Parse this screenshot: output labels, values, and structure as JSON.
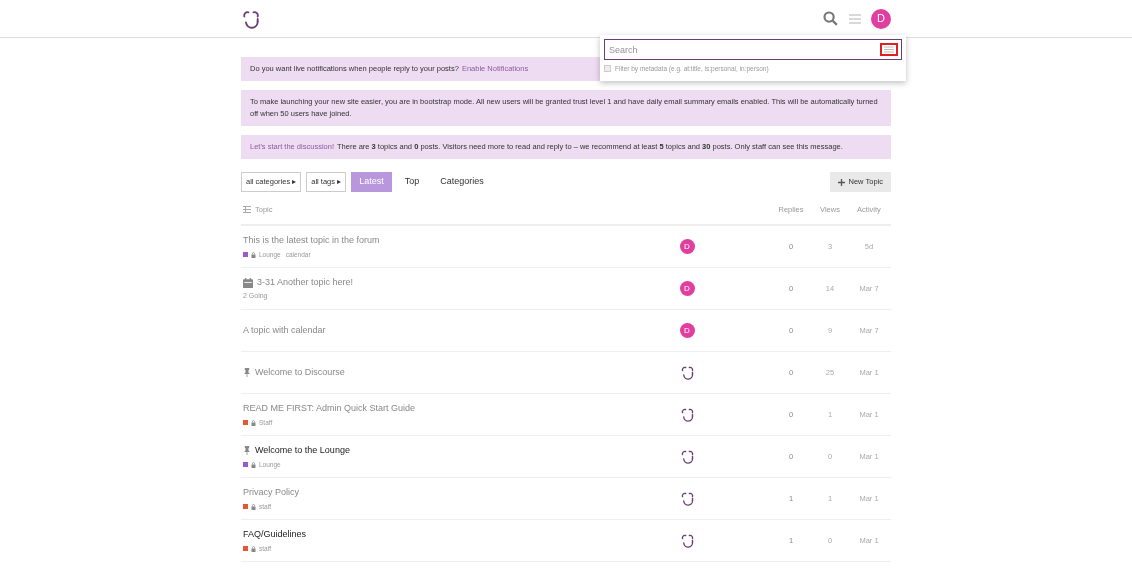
{
  "header": {
    "avatar": "D"
  },
  "search_menu": {
    "placeholder": "Search",
    "option": {
      "label": "Filter by metadata (e.g. at:title, is:personal, in:person)",
      "checked": false
    }
  },
  "banners": [
    {
      "text": "Do you want live notifications when people reply to your posts?",
      "link_after": "Enable Notifications"
    },
    {
      "text": "To make launching your new site easier, you are in bootstrap mode. All new users will be granted trust level 1 and have daily email summary emails enabled. This will be automatically turned off when 50 users have joined."
    },
    {
      "text": "There are **3** topics and **0** posts. Visitors need more to read and reply to – we recommend at least **5** topics and **30** posts. Only staff can see this message.",
      "link_before": "Let's start the discussion!"
    }
  ],
  "filters": [
    {
      "label": "all categories ▸"
    },
    {
      "label": "all tags ▸"
    }
  ],
  "nav": [
    {
      "label": "Latest",
      "selected": true
    },
    {
      "label": "Top",
      "selected": false
    },
    {
      "label": "Categories",
      "selected": false
    }
  ],
  "new_topic": "New Topic",
  "columns": [
    "Topic",
    "Replies",
    "Views",
    "Activity"
  ],
  "topics": [
    {
      "title": "This is the latest topic in the forum",
      "unread": false,
      "pinned": false,
      "event": false,
      "category": "Lounge",
      "color": "#9b59d0",
      "tag": "calendar",
      "poster": {
        "kind": "avatar",
        "label": "D"
      },
      "replies": "0",
      "views": "3",
      "activity": "5d"
    },
    {
      "title": "3-31 Another topic here!",
      "unread": false,
      "pinned": false,
      "event": true,
      "sub": "2 Going",
      "poster": {
        "kind": "avatar",
        "label": "D"
      },
      "replies": "0",
      "views": "14",
      "activity": "Mar 7"
    },
    {
      "title": "A topic with calendar",
      "unread": false,
      "pinned": false,
      "event": false,
      "poster": {
        "kind": "avatar",
        "label": "D"
      },
      "replies": "0",
      "views": "9",
      "activity": "Mar 7"
    },
    {
      "title": "Welcome to Discourse",
      "unread": false,
      "pinned": true,
      "event": false,
      "poster": {
        "kind": "logo"
      },
      "replies": "0",
      "views": "25",
      "activity": "Mar 1"
    },
    {
      "title": "READ ME FIRST: Admin Quick Start Guide",
      "unread": false,
      "pinned": false,
      "event": false,
      "category": "Staff",
      "color": "#e45735",
      "poster": {
        "kind": "logo"
      },
      "replies": "0",
      "views": "1",
      "activity": "Mar 1"
    },
    {
      "title": "Welcome to the Lounge",
      "unread": true,
      "pinned": true,
      "event": false,
      "category": "Lounge",
      "color": "#9b59d0",
      "poster": {
        "kind": "logo"
      },
      "replies": "0",
      "views": "0",
      "activity": "Mar 1"
    },
    {
      "title": "Privacy Policy",
      "unread": false,
      "pinned": false,
      "event": false,
      "category": "staff",
      "color": "#e45735",
      "poster": {
        "kind": "logo"
      },
      "replies": "1",
      "views": "1",
      "activity": "Mar 1"
    },
    {
      "title": "FAQ/Guidelines",
      "unread": true,
      "pinned": false,
      "event": false,
      "category": "staff",
      "color": "#e45735",
      "poster": {
        "kind": "logo"
      },
      "replies": "1",
      "views": "0",
      "activity": "Mar 1"
    }
  ]
}
